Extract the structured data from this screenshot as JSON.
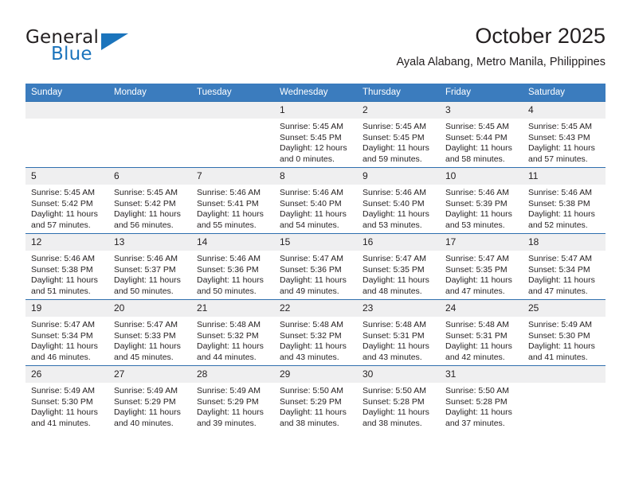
{
  "brand": {
    "name_primary": "General",
    "name_secondary": "Blue",
    "accent_color": "#1b74bc"
  },
  "header": {
    "title": "October 2025",
    "subtitle": "Ayala Alabang, Metro Manila, Philippines"
  },
  "theme": {
    "header_bg": "#3b7cbe",
    "header_text": "#ffffff",
    "daynum_bg": "#efeff0",
    "row_divider": "#2f6fae",
    "text": "#231f20"
  },
  "calendar": {
    "weekday_headers": [
      "Sunday",
      "Monday",
      "Tuesday",
      "Wednesday",
      "Thursday",
      "Friday",
      "Saturday"
    ],
    "labels": {
      "sunrise": "Sunrise:",
      "sunset": "Sunset:",
      "daylight": "Daylight:"
    },
    "weeks": [
      [
        {
          "day": "",
          "blank": true
        },
        {
          "day": "",
          "blank": true
        },
        {
          "day": "",
          "blank": true
        },
        {
          "day": "1",
          "sunrise": "Sunrise: 5:45 AM",
          "sunset": "Sunset: 5:45 PM",
          "daylight": "Daylight: 12 hours and 0 minutes."
        },
        {
          "day": "2",
          "sunrise": "Sunrise: 5:45 AM",
          "sunset": "Sunset: 5:45 PM",
          "daylight": "Daylight: 11 hours and 59 minutes."
        },
        {
          "day": "3",
          "sunrise": "Sunrise: 5:45 AM",
          "sunset": "Sunset: 5:44 PM",
          "daylight": "Daylight: 11 hours and 58 minutes."
        },
        {
          "day": "4",
          "sunrise": "Sunrise: 5:45 AM",
          "sunset": "Sunset: 5:43 PM",
          "daylight": "Daylight: 11 hours and 57 minutes."
        }
      ],
      [
        {
          "day": "5",
          "sunrise": "Sunrise: 5:45 AM",
          "sunset": "Sunset: 5:42 PM",
          "daylight": "Daylight: 11 hours and 57 minutes."
        },
        {
          "day": "6",
          "sunrise": "Sunrise: 5:45 AM",
          "sunset": "Sunset: 5:42 PM",
          "daylight": "Daylight: 11 hours and 56 minutes."
        },
        {
          "day": "7",
          "sunrise": "Sunrise: 5:46 AM",
          "sunset": "Sunset: 5:41 PM",
          "daylight": "Daylight: 11 hours and 55 minutes."
        },
        {
          "day": "8",
          "sunrise": "Sunrise: 5:46 AM",
          "sunset": "Sunset: 5:40 PM",
          "daylight": "Daylight: 11 hours and 54 minutes."
        },
        {
          "day": "9",
          "sunrise": "Sunrise: 5:46 AM",
          "sunset": "Sunset: 5:40 PM",
          "daylight": "Daylight: 11 hours and 53 minutes."
        },
        {
          "day": "10",
          "sunrise": "Sunrise: 5:46 AM",
          "sunset": "Sunset: 5:39 PM",
          "daylight": "Daylight: 11 hours and 53 minutes."
        },
        {
          "day": "11",
          "sunrise": "Sunrise: 5:46 AM",
          "sunset": "Sunset: 5:38 PM",
          "daylight": "Daylight: 11 hours and 52 minutes."
        }
      ],
      [
        {
          "day": "12",
          "sunrise": "Sunrise: 5:46 AM",
          "sunset": "Sunset: 5:38 PM",
          "daylight": "Daylight: 11 hours and 51 minutes."
        },
        {
          "day": "13",
          "sunrise": "Sunrise: 5:46 AM",
          "sunset": "Sunset: 5:37 PM",
          "daylight": "Daylight: 11 hours and 50 minutes."
        },
        {
          "day": "14",
          "sunrise": "Sunrise: 5:46 AM",
          "sunset": "Sunset: 5:36 PM",
          "daylight": "Daylight: 11 hours and 50 minutes."
        },
        {
          "day": "15",
          "sunrise": "Sunrise: 5:47 AM",
          "sunset": "Sunset: 5:36 PM",
          "daylight": "Daylight: 11 hours and 49 minutes."
        },
        {
          "day": "16",
          "sunrise": "Sunrise: 5:47 AM",
          "sunset": "Sunset: 5:35 PM",
          "daylight": "Daylight: 11 hours and 48 minutes."
        },
        {
          "day": "17",
          "sunrise": "Sunrise: 5:47 AM",
          "sunset": "Sunset: 5:35 PM",
          "daylight": "Daylight: 11 hours and 47 minutes."
        },
        {
          "day": "18",
          "sunrise": "Sunrise: 5:47 AM",
          "sunset": "Sunset: 5:34 PM",
          "daylight": "Daylight: 11 hours and 47 minutes."
        }
      ],
      [
        {
          "day": "19",
          "sunrise": "Sunrise: 5:47 AM",
          "sunset": "Sunset: 5:34 PM",
          "daylight": "Daylight: 11 hours and 46 minutes."
        },
        {
          "day": "20",
          "sunrise": "Sunrise: 5:47 AM",
          "sunset": "Sunset: 5:33 PM",
          "daylight": "Daylight: 11 hours and 45 minutes."
        },
        {
          "day": "21",
          "sunrise": "Sunrise: 5:48 AM",
          "sunset": "Sunset: 5:32 PM",
          "daylight": "Daylight: 11 hours and 44 minutes."
        },
        {
          "day": "22",
          "sunrise": "Sunrise: 5:48 AM",
          "sunset": "Sunset: 5:32 PM",
          "daylight": "Daylight: 11 hours and 43 minutes."
        },
        {
          "day": "23",
          "sunrise": "Sunrise: 5:48 AM",
          "sunset": "Sunset: 5:31 PM",
          "daylight": "Daylight: 11 hours and 43 minutes."
        },
        {
          "day": "24",
          "sunrise": "Sunrise: 5:48 AM",
          "sunset": "Sunset: 5:31 PM",
          "daylight": "Daylight: 11 hours and 42 minutes."
        },
        {
          "day": "25",
          "sunrise": "Sunrise: 5:49 AM",
          "sunset": "Sunset: 5:30 PM",
          "daylight": "Daylight: 11 hours and 41 minutes."
        }
      ],
      [
        {
          "day": "26",
          "sunrise": "Sunrise: 5:49 AM",
          "sunset": "Sunset: 5:30 PM",
          "daylight": "Daylight: 11 hours and 41 minutes."
        },
        {
          "day": "27",
          "sunrise": "Sunrise: 5:49 AM",
          "sunset": "Sunset: 5:29 PM",
          "daylight": "Daylight: 11 hours and 40 minutes."
        },
        {
          "day": "28",
          "sunrise": "Sunrise: 5:49 AM",
          "sunset": "Sunset: 5:29 PM",
          "daylight": "Daylight: 11 hours and 39 minutes."
        },
        {
          "day": "29",
          "sunrise": "Sunrise: 5:50 AM",
          "sunset": "Sunset: 5:29 PM",
          "daylight": "Daylight: 11 hours and 38 minutes."
        },
        {
          "day": "30",
          "sunrise": "Sunrise: 5:50 AM",
          "sunset": "Sunset: 5:28 PM",
          "daylight": "Daylight: 11 hours and 38 minutes."
        },
        {
          "day": "31",
          "sunrise": "Sunrise: 5:50 AM",
          "sunset": "Sunset: 5:28 PM",
          "daylight": "Daylight: 11 hours and 37 minutes."
        },
        {
          "day": "",
          "blank": true
        }
      ]
    ]
  }
}
